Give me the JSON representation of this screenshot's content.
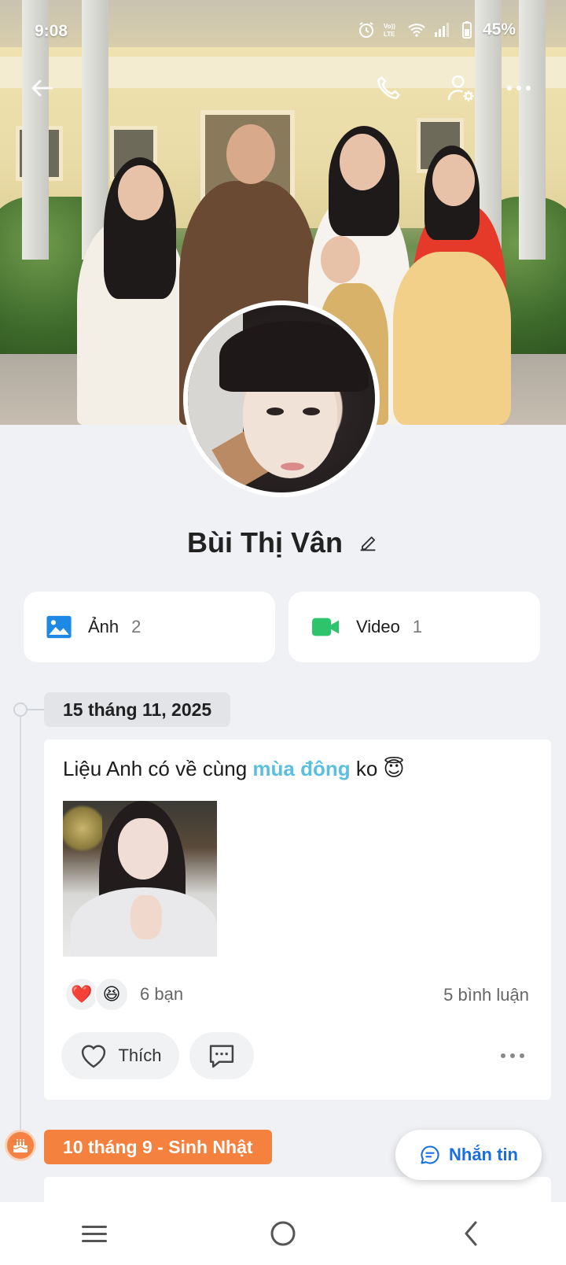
{
  "status": {
    "time": "9:08",
    "battery": "45%"
  },
  "profile": {
    "name": "Bùi Thị Vân"
  },
  "media": [
    {
      "label": "Ảnh",
      "count": "2",
      "icon": "image-icon",
      "color": "#1e88e5"
    },
    {
      "label": "Video",
      "count": "1",
      "icon": "video-camera-icon",
      "color": "#2ec46b"
    }
  ],
  "timeline": {
    "post": {
      "date": "15 tháng 11, 2025",
      "text_before": "Liệu Anh có về cùng ",
      "text_highlight": "mùa đông",
      "text_after": " ko ",
      "emoji": "😇",
      "reaction_emojis": [
        "❤️",
        "😆"
      ],
      "reaction_count": "6 bạn",
      "comment_count": "5 bình luận",
      "like_label": "Thích"
    },
    "birthday": {
      "label": "10 tháng 9 - Sinh Nhật"
    }
  },
  "message_button": {
    "label": "Nhắn tin"
  },
  "colors": {
    "accent": "#1a6fe0",
    "birthday": "#f5813e",
    "highlight": "#5bbfe0"
  }
}
